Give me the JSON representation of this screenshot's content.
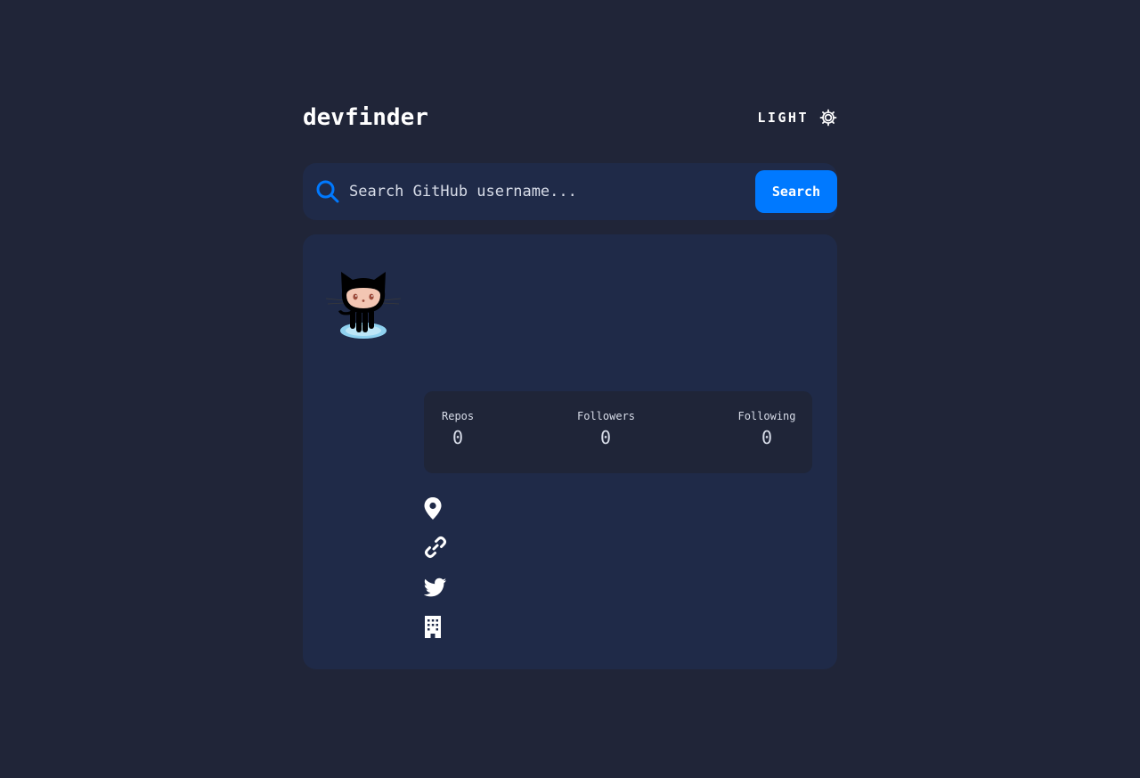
{
  "header": {
    "brand": "devfinder",
    "theme_label": "LIGHT"
  },
  "search": {
    "placeholder": "Search GitHub username...",
    "value": "",
    "button_label": "Search"
  },
  "profile": {
    "stats": [
      {
        "label": "Repos",
        "value": "0"
      },
      {
        "label": "Followers",
        "value": "0"
      },
      {
        "label": "Following",
        "value": "0"
      }
    ],
    "links": [
      {
        "icon": "location-pin-icon"
      },
      {
        "icon": "link-icon"
      },
      {
        "icon": "twitter-icon"
      },
      {
        "icon": "building-icon"
      }
    ]
  },
  "colors": {
    "background": "#202538",
    "card": "#1f2a48",
    "stats_box": "#1f2538",
    "accent": "#0079ff",
    "text": "#ffffff",
    "muted_text": "#d7dce8"
  }
}
